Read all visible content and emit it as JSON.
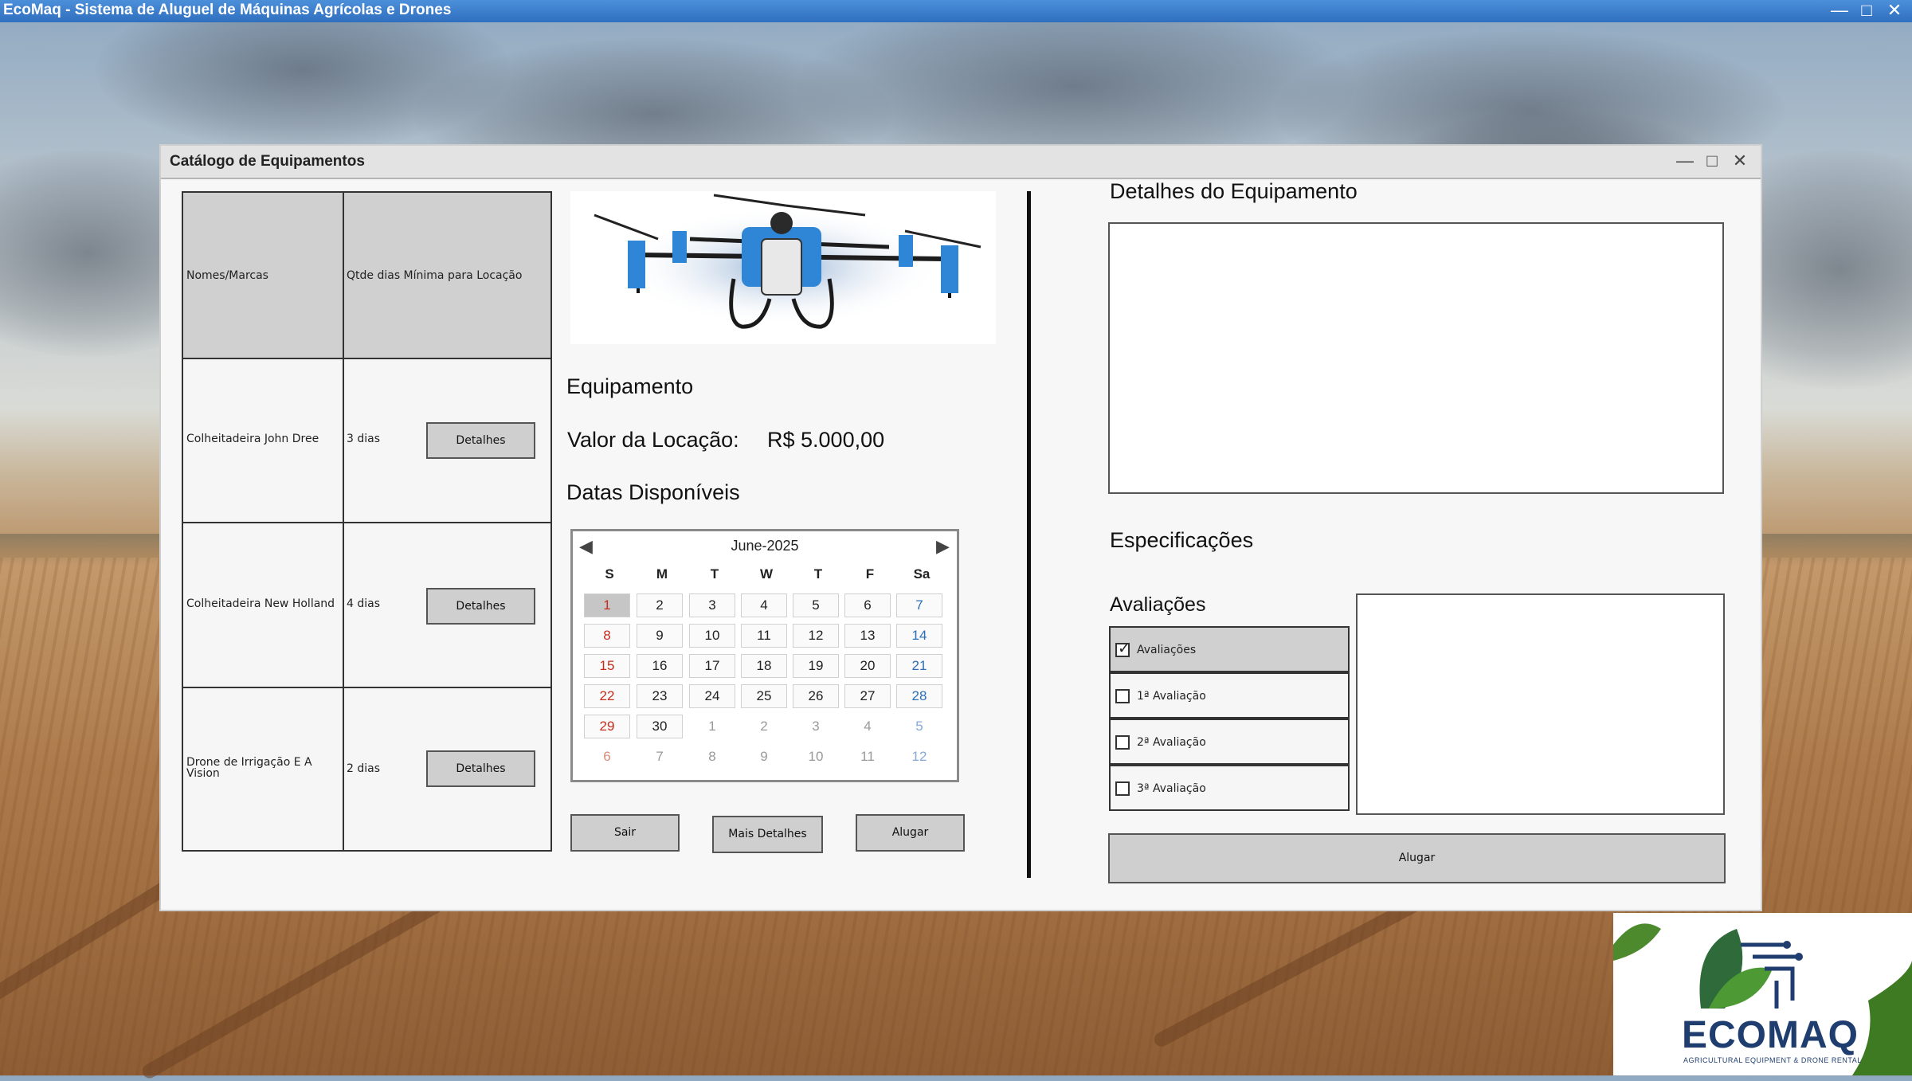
{
  "app": {
    "title": "EcoMaq - Sistema de Aluguel de Máquinas Agrícolas e Drones"
  },
  "dialog": {
    "title": "Catálogo de Equipamentos"
  },
  "table": {
    "headers": [
      "Nomes/Marcas",
      "Qtde dias Mínima para Locação"
    ],
    "rows": [
      {
        "name": "Colheitadeira John Dree",
        "days": "3 dias",
        "button": "Detalhes"
      },
      {
        "name": "Colheitadeira New Holland",
        "days": "4 dias",
        "button": "Detalhes"
      },
      {
        "name": "Drone de Irrigação E A Vision",
        "days": "2 dias",
        "button": "Detalhes"
      }
    ]
  },
  "equipment": {
    "heading": "Equipamento",
    "price_label": "Valor da Locação:",
    "price_value": "R$ 5.000,00",
    "dates_heading": "Datas Disponíveis"
  },
  "calendar": {
    "month": "June-2025",
    "weekdays": [
      "S",
      "M",
      "T",
      "W",
      "T",
      "F",
      "Sa"
    ],
    "selected_day": "1",
    "weeks": [
      [
        "1",
        "2",
        "3",
        "4",
        "5",
        "6",
        "7"
      ],
      [
        "8",
        "9",
        "10",
        "11",
        "12",
        "13",
        "14"
      ],
      [
        "15",
        "16",
        "17",
        "18",
        "19",
        "20",
        "21"
      ],
      [
        "22",
        "23",
        "24",
        "25",
        "26",
        "27",
        "28"
      ],
      [
        "29",
        "30",
        "1",
        "2",
        "3",
        "4",
        "5"
      ],
      [
        "6",
        "7",
        "8",
        "9",
        "10",
        "11",
        "12"
      ]
    ]
  },
  "actions": {
    "exit": "Sair",
    "more_details": "Mais Detalhes",
    "rent": "Alugar"
  },
  "details": {
    "heading": "Detalhes do Equipamento",
    "specs_heading": "Especificações",
    "reviews_heading": "Avaliações",
    "reviews": [
      {
        "label": "Avaliações",
        "checked": true
      },
      {
        "label": "1ª Avaliação",
        "checked": false
      },
      {
        "label": "2ª Avaliação",
        "checked": false
      },
      {
        "label": "3ª Avaliação",
        "checked": false
      }
    ],
    "rent_button": "Alugar"
  },
  "logo": {
    "name": "ECOMAQ",
    "tagline": "AGRICULTURAL EQUIPMENT & DRONE RENTAL"
  },
  "colors": {
    "titlebar": "#2f6fbf",
    "sunday": "#c62b1c",
    "saturday": "#2c6fb8",
    "brand": "#1f3e6f"
  }
}
